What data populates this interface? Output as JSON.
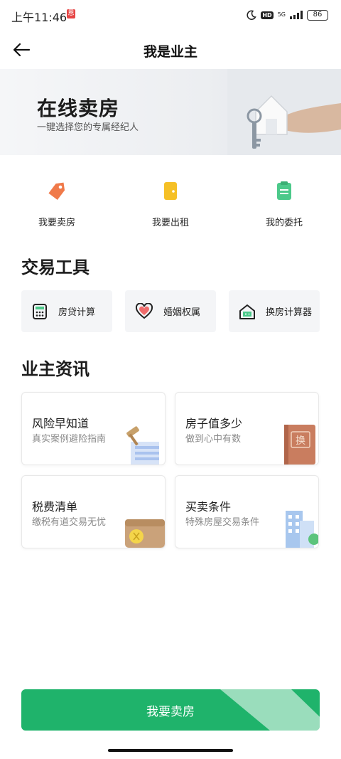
{
  "status_bar": {
    "time": "上午11:46",
    "notification_badge": "恩",
    "hd": "HD",
    "network": "5G",
    "battery": "86"
  },
  "nav": {
    "title": "我是业主"
  },
  "banner": {
    "title": "在线卖房",
    "subtitle": "一键选择您的专属经纪人"
  },
  "quick_actions": [
    {
      "label": "我要卖房",
      "icon": "tag-icon",
      "color": "#f07a4a"
    },
    {
      "label": "我要出租",
      "icon": "door-icon",
      "color": "#f5c026"
    },
    {
      "label": "我的委托",
      "icon": "clipboard-icon",
      "color": "#4cc98a"
    }
  ],
  "tools_section": {
    "title": "交易工具",
    "items": [
      {
        "label": "房贷计算",
        "icon": "calculator-icon"
      },
      {
        "label": "婚姻权属",
        "icon": "heart-icon"
      },
      {
        "label": "换房计算器",
        "icon": "house-calculator-icon"
      }
    ]
  },
  "info_section": {
    "title": "业主资讯",
    "cards": [
      {
        "title": "风险早知道",
        "subtitle": "真实案例避险指南",
        "icon": "gavel-icon"
      },
      {
        "title": "房子值多少",
        "subtitle": "做到心中有数",
        "icon": "property-book-icon",
        "art_text": "换"
      },
      {
        "title": "税费清单",
        "subtitle": "缴税有道交易无忧",
        "icon": "wallet-icon"
      },
      {
        "title": "买卖条件",
        "subtitle": "特殊房屋交易条件",
        "icon": "building-icon"
      }
    ]
  },
  "cta": {
    "label": "我要卖房",
    "color": "#1fb36b"
  }
}
